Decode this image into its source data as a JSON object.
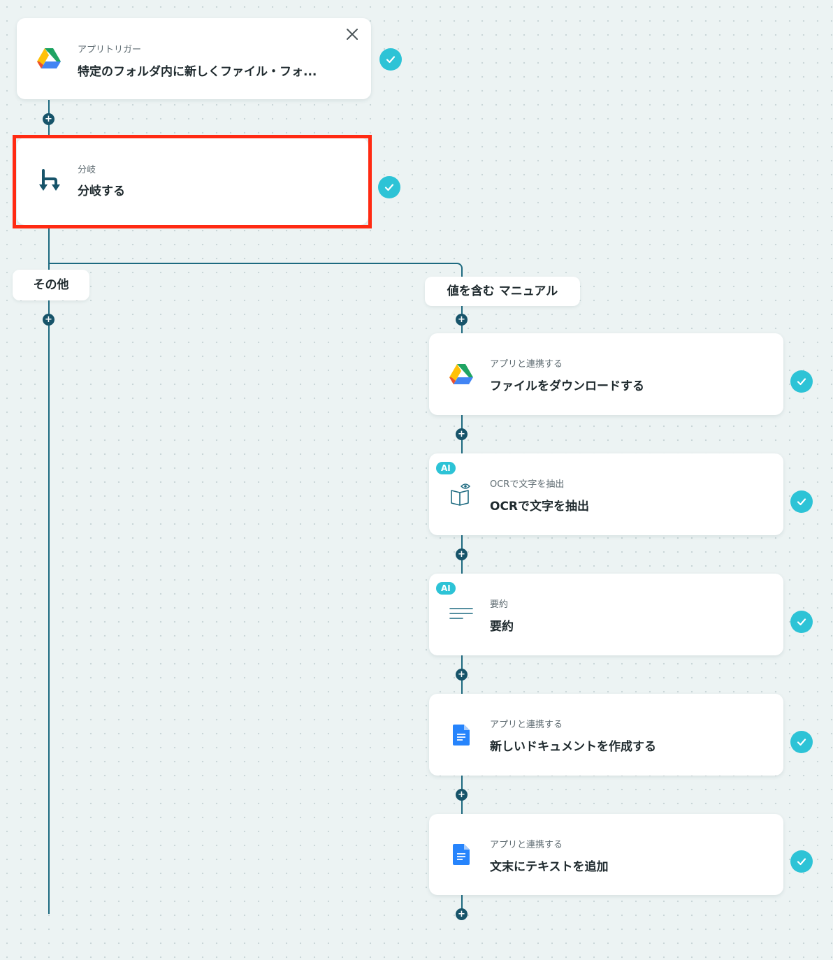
{
  "trigger": {
    "sub": "アプリトリガー",
    "title": "特定のフォルダ内に新しくファイル・フォ...",
    "icon": "google-drive-icon"
  },
  "branch_step": {
    "sub": "分岐",
    "title": "分岐する",
    "icon": "branch-icon"
  },
  "branches": {
    "other_label": "その他",
    "match_label": "値を含む マニュアル"
  },
  "steps": [
    {
      "sub": "アプリと連携する",
      "title": "ファイルをダウンロードする",
      "icon": "google-drive-icon"
    },
    {
      "badge": "AI",
      "sub": "OCRで文字を抽出",
      "title": "OCRで文字を抽出",
      "icon": "ocr-book-icon"
    },
    {
      "badge": "AI",
      "sub": "要約",
      "title": "要約",
      "icon": "summary-lines-icon"
    },
    {
      "sub": "アプリと連携する",
      "title": "新しいドキュメントを作成する",
      "icon": "google-docs-icon"
    },
    {
      "sub": "アプリと連携する",
      "title": "文末にテキストを追加",
      "icon": "google-docs-icon"
    }
  ],
  "plus_symbol": "+",
  "colors": {
    "line": "#1d6a80",
    "check": "#2dc3d6",
    "highlight": "#ff2a12",
    "plus": "#17546a"
  }
}
